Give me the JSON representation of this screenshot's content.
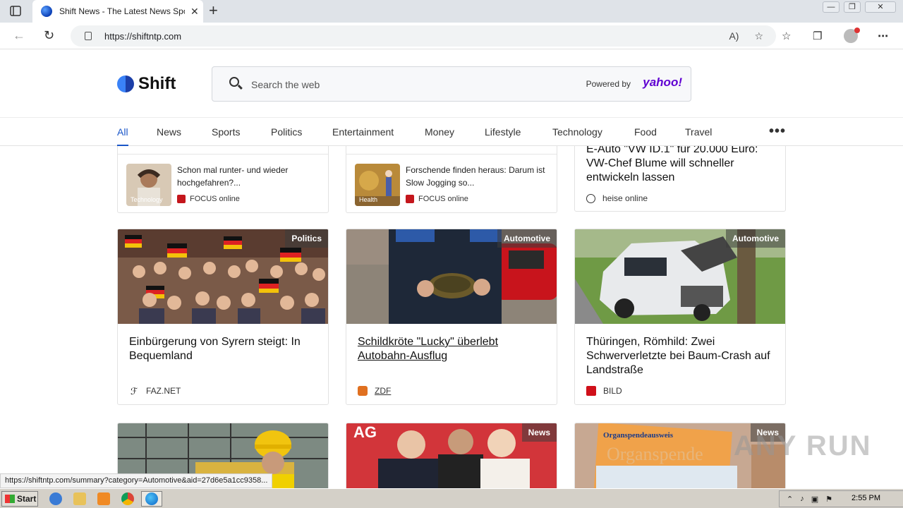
{
  "browser": {
    "tab_title": "Shift News - The Latest News Spo",
    "tab_close": "✕",
    "new_tab": "+",
    "url": "https://shiftntp.com",
    "window_controls": [
      "—",
      "❐",
      "✕"
    ]
  },
  "site": {
    "logo_text": "Shift",
    "search_placeholder": "Search the web",
    "powered_by": "Powered by",
    "powered_brand": "yahoo!"
  },
  "nav": {
    "items": [
      "All",
      "News",
      "Sports",
      "Politics",
      "Entertainment",
      "Money",
      "Lifestyle",
      "Technology",
      "Food",
      "Travel"
    ],
    "more": "•••"
  },
  "top_cards": [
    {
      "tag": "Technology",
      "title": "Schon mal runter- und wieder hochgefahren?...",
      "source": "FOCUS online"
    },
    {
      "tag": "Health",
      "title": "Forschende finden heraus: Darum ist Slow Jogging so...",
      "source": "FOCUS online"
    },
    {
      "title": "E-Auto \"VW ID.1\" für 20.000 Euro: VW-Chef Blume will schneller entwickeln lassen",
      "source": "heise online"
    }
  ],
  "cards": [
    {
      "category": "Politics",
      "title": "Einbürgerung von Syrern steigt: In Bequemland",
      "source": "FAZ.NET"
    },
    {
      "category": "Automotive",
      "title": "Schildkröte \"Lucky\" überlebt Autobahn-Ausflug",
      "source": "ZDF"
    },
    {
      "category": "Automotive",
      "title": "Thüringen, Römhild: Zwei Schwerverletzte bei Baum-Crash auf Landstraße",
      "source": "BILD"
    }
  ],
  "bottom_cards": [
    {
      "category": ""
    },
    {
      "category": "News"
    },
    {
      "category": "News"
    }
  ],
  "status_url": "https://shiftntp.com/summary?category=Automotive&aid=27d6e5a1cc9358...",
  "watermark": "ANY RUN",
  "taskbar": {
    "start": "Start",
    "clock": "2:55 PM"
  },
  "colors": {
    "accent": "#1a56c8",
    "yahoo": "#6001d2"
  }
}
